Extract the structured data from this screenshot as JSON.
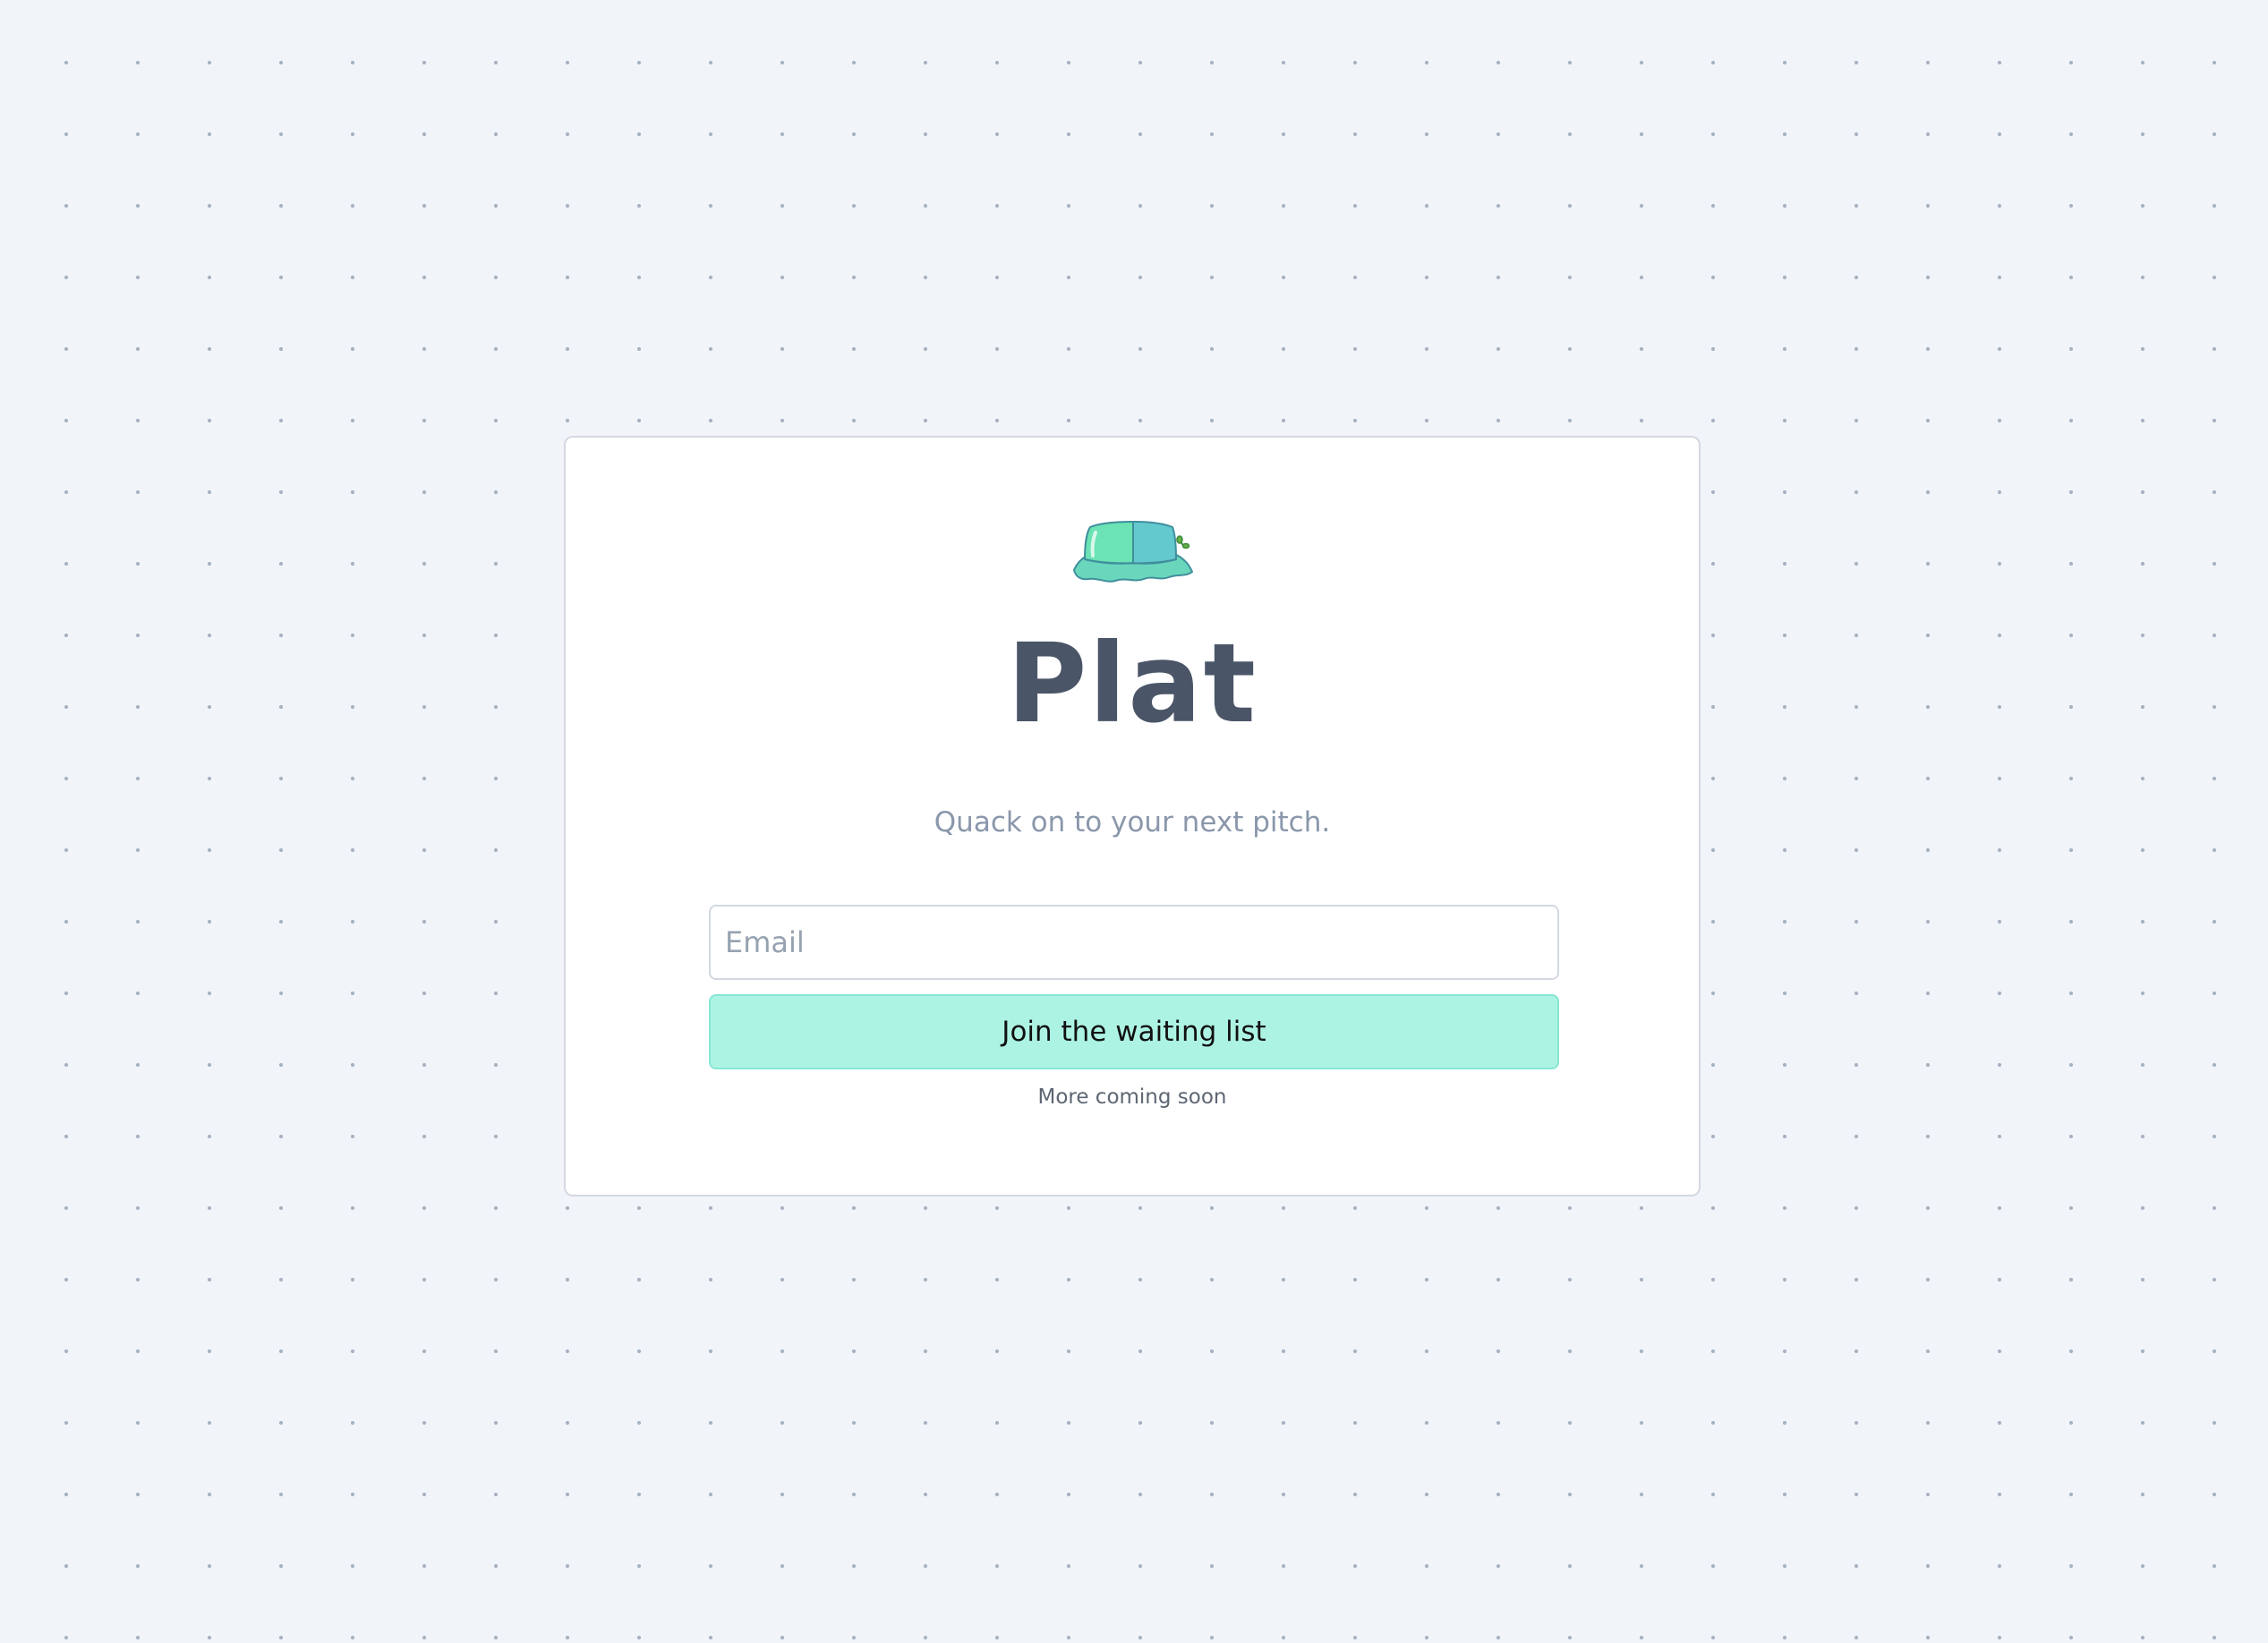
{
  "app": {
    "logo_icon": "bucket-hat-icon",
    "title": "Plat",
    "tagline": "Quack on to your next pitch."
  },
  "form": {
    "email_placeholder": "Email",
    "email_value": "",
    "submit_label": "Join the waiting list"
  },
  "footer": {
    "note": "More coming soon"
  },
  "colors": {
    "background": "#f1f5f9",
    "card": "#ffffff",
    "title": "#4a5568",
    "tagline": "#8a97ab",
    "button_fill": "#adf3e3",
    "button_border": "#86e7d2",
    "hat_green": "#6be3b4",
    "hat_teal": "#64c8cf"
  }
}
